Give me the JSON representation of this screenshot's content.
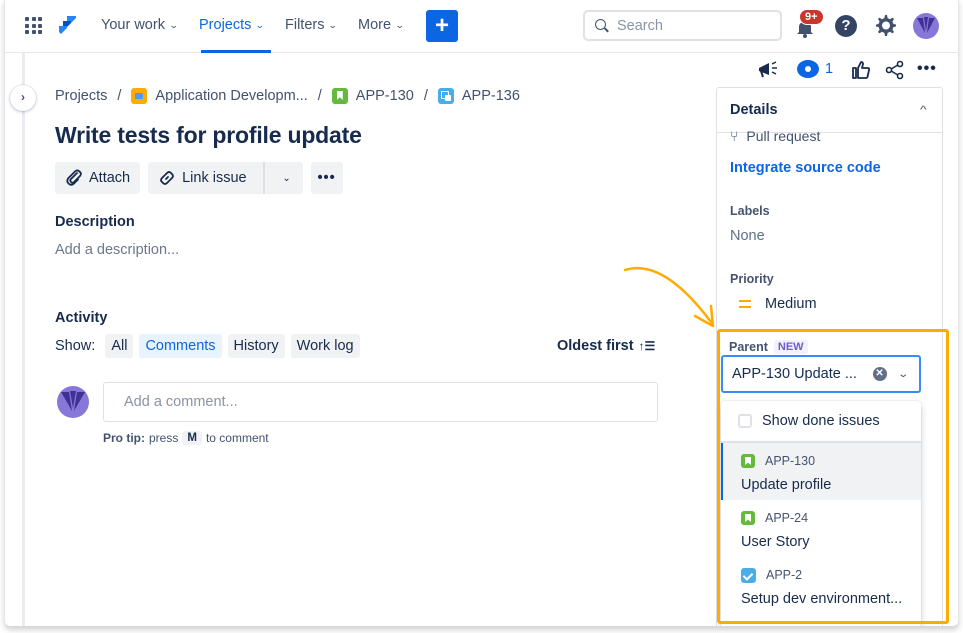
{
  "nav": {
    "items": [
      {
        "label": "Your work",
        "active": false
      },
      {
        "label": "Projects",
        "active": true
      },
      {
        "label": "Filters",
        "active": false
      },
      {
        "label": "More",
        "active": false
      }
    ],
    "create_label": "+",
    "search_placeholder": "Search",
    "notification_badge": "9+",
    "help_label": "?"
  },
  "breadcrumb": [
    {
      "label": "Projects",
      "icon": "none"
    },
    {
      "label": "Application Developm...",
      "icon": "project-icon"
    },
    {
      "label": "APP-130",
      "icon": "story-icon"
    },
    {
      "label": "APP-136",
      "icon": "subtask-icon"
    }
  ],
  "breadcrumb_separator": "/",
  "issue": {
    "title": "Write tests for profile update",
    "toolbar": {
      "attach_label": "Attach",
      "link_issue_label": "Link issue",
      "more_label": "•••"
    },
    "description_label": "Description",
    "description_placeholder": "Add a description..."
  },
  "activity": {
    "label": "Activity",
    "show_label": "Show:",
    "filters": [
      {
        "label": "All",
        "active": false
      },
      {
        "label": "Comments",
        "active": true
      },
      {
        "label": "History",
        "active": false
      },
      {
        "label": "Work log",
        "active": false
      }
    ],
    "sort_label": "Oldest first",
    "comment_placeholder": "Add a comment...",
    "protip_bold": "Pro tip:",
    "protip_pre": "press",
    "protip_key": "M",
    "protip_post": "to comment"
  },
  "actions": {
    "watch_count": "1",
    "more_label": "•••"
  },
  "details": {
    "title": "Details",
    "pull_request_label": "Pull request",
    "integrate_link": "Integrate source code",
    "labels_label": "Labels",
    "labels_value": "None",
    "priority_label": "Priority",
    "priority_value": "Medium",
    "parent_label": "Parent",
    "parent_badge": "NEW",
    "parent_value": "APP-130 Update ...",
    "dropdown": {
      "show_done_label": "Show done issues",
      "show_done_checked": false,
      "options": [
        {
          "key": "APP-130",
          "summary": "Update profile",
          "type": "story",
          "selected": true
        },
        {
          "key": "APP-24",
          "summary": "User Story",
          "type": "story",
          "selected": false
        },
        {
          "key": "APP-2",
          "summary": "Setup dev environment...",
          "type": "task",
          "selected": false
        }
      ]
    }
  },
  "colors": {
    "brand_blue": "#0C66E4",
    "highlight": "#FFAB00",
    "badge_red": "#C9372C",
    "story_green": "#63BA3C",
    "task_blue": "#4BADE8"
  }
}
